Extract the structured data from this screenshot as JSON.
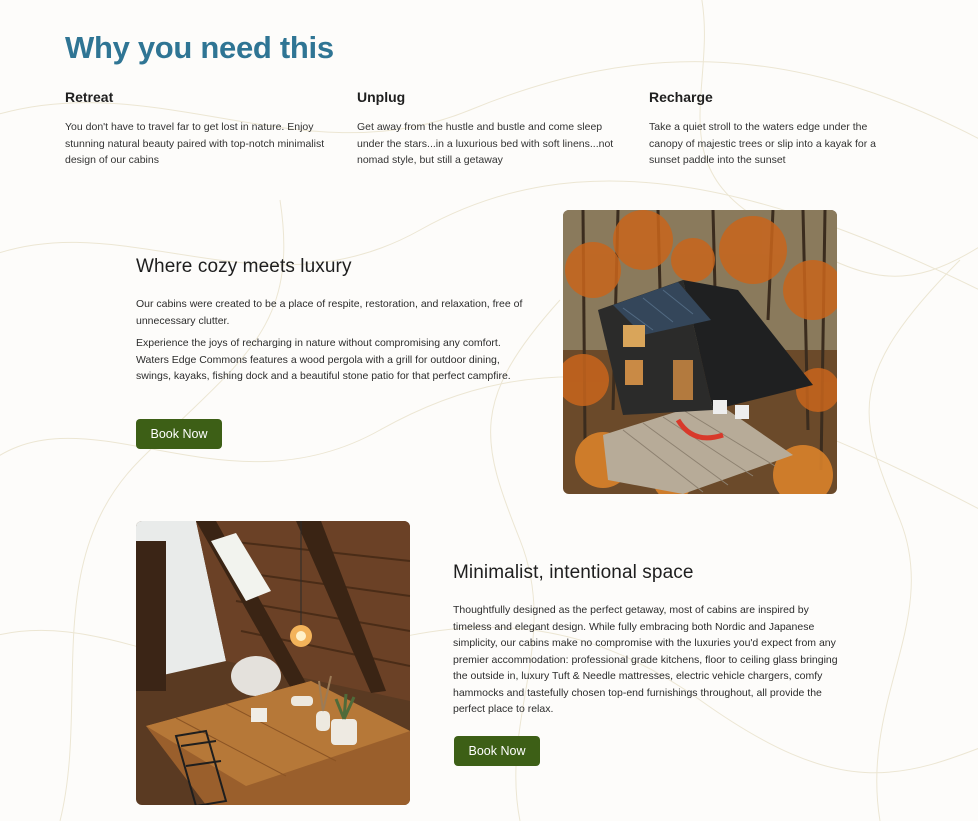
{
  "page": {
    "title": "Why you need this"
  },
  "features": [
    {
      "heading": "Retreat",
      "text": "You don't have to travel far to get lost in nature. Enjoy stunning natural beauty paired with top-notch minimalist design of our cabins"
    },
    {
      "heading": "Unplug",
      "text": "Get away from the hustle and bustle and come sleep under the stars...in a luxurious bed with soft linens...not nomad style, but still a getaway"
    },
    {
      "heading": "Recharge",
      "text": "Take a quiet stroll to the waters edge under the canopy of majestic trees or slip into a kayak for a sunset paddle into the sunset"
    }
  ],
  "section_cozy": {
    "heading": "Where cozy meets luxury",
    "paragraph_1": "Our cabins were created to be a place of respite, restoration, and relaxation, free of unnecessary clutter.",
    "paragraph_2": "Experience the joys of recharging in nature without compromising any comfort. Waters Edge Commons features a wood pergola with a grill for outdoor dining, swings, kayaks, fishing dock and a beautiful stone patio for that perfect campfire.",
    "button_label": "Book Now"
  },
  "section_minimal": {
    "heading": "Minimalist, intentional space",
    "paragraph": "Thoughtfully designed as the perfect getaway, most of cabins are inspired by timeless and elegant design. While fully embracing both Nordic and Japanese simplicity, our cabins make no compromise with the luxuries you'd expect from any premier accommodation: professional grade kitchens, floor to ceiling glass bringing the outside in, luxury Tuft & Needle mattresses, electric vehicle chargers, comfy hammocks and tastefully chosen top-end furnishings throughout, all provide the perfect place to relax.",
    "button_label": "Book Now"
  },
  "colors": {
    "title": "#2f7594",
    "button": "#3d5f16",
    "background": "#fdfcfa"
  }
}
